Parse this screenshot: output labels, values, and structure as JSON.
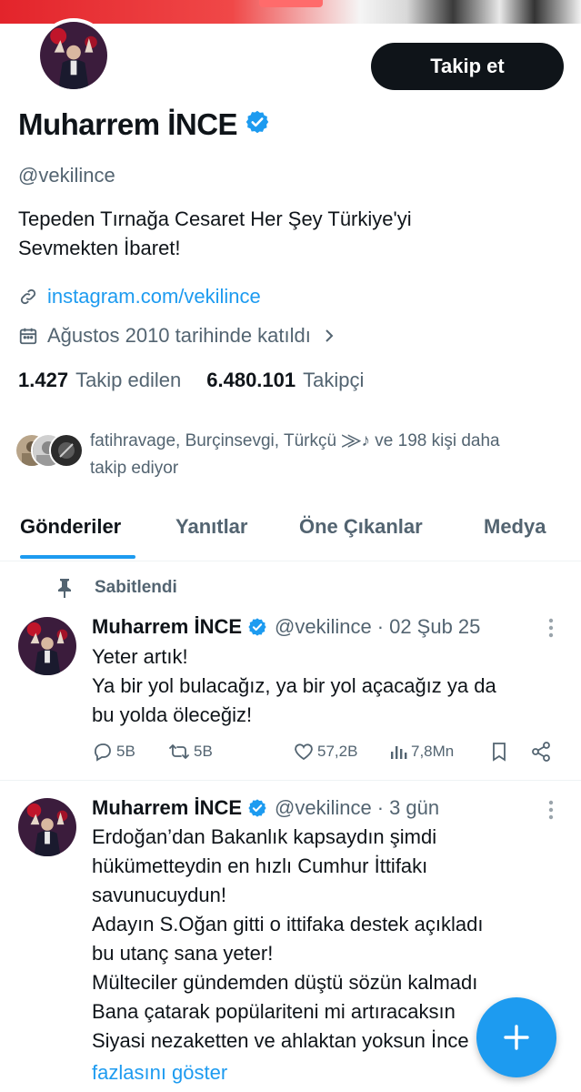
{
  "profile": {
    "follow_label": "Takip et",
    "name": "Muharrem İNCE",
    "handle": "@vekilince",
    "bio_line1": "Tepeden Tırnağa Cesaret Her Şey Türkiye'yi",
    "bio_line2": "Sevmekten İbaret!",
    "link": "instagram.com/vekilince",
    "joined": "Ağustos 2010 tarihinde katıldı",
    "following_count": "1.427",
    "following_label": "Takip edilen",
    "followers_count": "6.480.101",
    "followers_label": "Takipçi",
    "followed_by_line1": "fatihravage, Burçinsevgi, Türkçü  ⨠♪ ve 198 kişi daha",
    "followed_by_line2": "takip ediyor"
  },
  "tabs": [
    "Gönderiler",
    "Yanıtlar",
    "Öne Çıkanlar",
    "Medya"
  ],
  "pinned_label": "Sabitlendi",
  "tweets": [
    {
      "name": "Muharrem İNCE",
      "handle": "@vekilince",
      "date": "02 Şub 25",
      "lines": [
        "Yeter artık!",
        "Ya bir yol bulacağız, ya bir yol açacağız ya da",
        "bu yolda öleceğiz!"
      ],
      "replies": "5B",
      "retweets": "5B",
      "likes": "57,2B",
      "views": "7,8Mn"
    },
    {
      "name": "Muharrem İNCE",
      "handle": "@vekilince",
      "date": "3 gün",
      "lines": [
        "Erdoğan’dan Bakanlık kapsaydın şimdi",
        "hükümetteydin en hızlı Cumhur İttifakı",
        "savunucuydun!",
        "Adayın S.Oğan gitti o ittifaka destek açıkladı",
        "bu utanç sana yeter!",
        "Mülteciler gündemden düştü sözün kalmadı",
        "Bana çatarak popülariteni mi artıracaksın",
        "Siyasi nezaketten ve ahlaktan yoksun İnce"
      ],
      "show_more": "fazlasını göster"
    }
  ],
  "colors": {
    "accent": "#1d9bf0",
    "text": "#0f1419",
    "muted": "#536471",
    "banner": "#e3242b"
  },
  "icons": [
    "verified-badge-icon",
    "link-icon",
    "calendar-icon",
    "chevron-right-icon",
    "pin-icon",
    "reply-icon",
    "retweet-icon",
    "like-icon",
    "views-icon",
    "bookmark-icon",
    "share-icon",
    "more-icon",
    "compose-plus-icon"
  ]
}
